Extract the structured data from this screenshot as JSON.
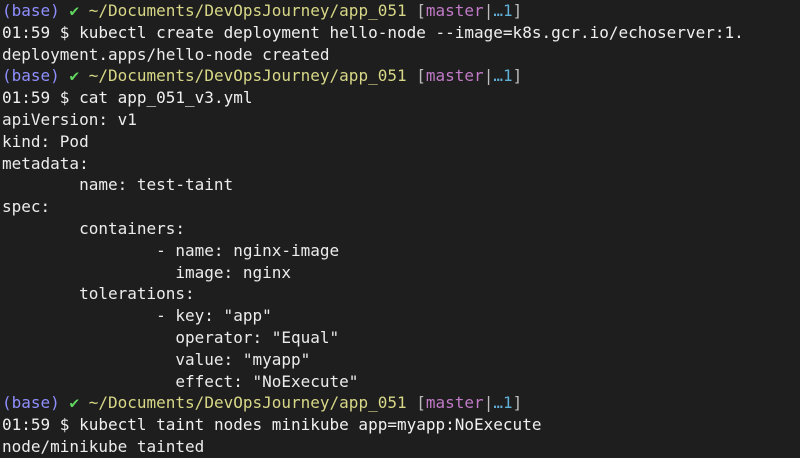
{
  "terminal": {
    "prompt": {
      "env": "(base)",
      "check": "✔",
      "path": "~/Documents/DevOpsJourney/app_051",
      "branch": "master",
      "ahead": "…1"
    },
    "lines": [
      {
        "kind": "prompt"
      },
      {
        "kind": "command",
        "time": "01:59",
        "text": "kubectl create deployment hello-node --image=k8s.gcr.io/echoserver:1."
      },
      {
        "kind": "output",
        "text": "deployment.apps/hello-node created"
      },
      {
        "kind": "prompt"
      },
      {
        "kind": "command",
        "time": "01:59",
        "text": "cat app_051_v3.yml"
      },
      {
        "kind": "output",
        "text": "apiVersion: v1"
      },
      {
        "kind": "output",
        "text": "kind: Pod"
      },
      {
        "kind": "output",
        "text": "metadata:"
      },
      {
        "kind": "output",
        "text": "        name: test-taint"
      },
      {
        "kind": "output",
        "text": "spec:"
      },
      {
        "kind": "output",
        "text": "        containers:"
      },
      {
        "kind": "output",
        "text": "                - name: nginx-image"
      },
      {
        "kind": "output",
        "text": "                  image: nginx"
      },
      {
        "kind": "output",
        "text": "        tolerations:"
      },
      {
        "kind": "output",
        "text": "                - key: \"app\""
      },
      {
        "kind": "output",
        "text": "                  operator: \"Equal\""
      },
      {
        "kind": "output",
        "text": "                  value: \"myapp\""
      },
      {
        "kind": "output",
        "text": "                  effect: \"NoExecute\""
      },
      {
        "kind": "prompt"
      },
      {
        "kind": "command",
        "time": "01:59",
        "text": "kubectl taint nodes minikube app=myapp:NoExecute"
      },
      {
        "kind": "output",
        "text": "node/minikube tainted"
      }
    ]
  }
}
